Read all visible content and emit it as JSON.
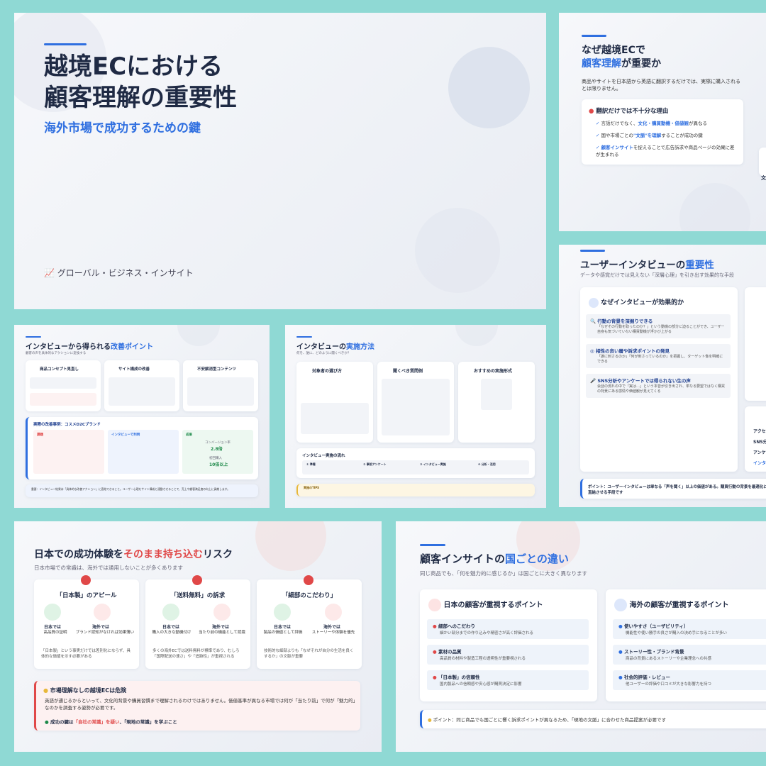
{
  "s1": {
    "title_l1": "越境ECにおける",
    "title_l2": "顧客理解の重要性",
    "subtitle": "海外市場で成功するための鍵",
    "footer": "グローバル・ビジネス・インサイト",
    "footer_icon": "chart-line-icon"
  },
  "s2": {
    "title_l1": "なぜ越境ECで",
    "title_l2a": "顧客理解",
    "title_l2b": "が重要か",
    "desc": "商品やサイトを日本語から英語に翻訳するだけでは、実際に購入されるとは限りません。",
    "card_title": "翻訳だけでは不十分な理由",
    "b1a": "言語だけでなく、",
    "b1b": "文化・購買動機・価値観",
    "b1c": "が異なる",
    "b2a": "国や市場ごとの",
    "b2b": "\"文脈\"を理解",
    "b2c": "することが成功の鍵",
    "b3a": "顧客インサイト",
    "b3b": "を捉えることで広告訴求や商品ページの効果に差が生まれる",
    "cut": "文"
  },
  "s3": {
    "title_a": "ユーザーインタビューの",
    "title_b": "重要性",
    "desc": "データや感覚だけでは見えない「深層心理」を引き出す効果的な手段",
    "card_title": "なぜインタビューが効果的か",
    "i1_t": "行動の背景を深掘りできる",
    "i1_d": "「なぜその行動を取ったのか？」という動機の部分に迫ることができ、ユーザー自身も気づいていない購買動機が浮かび上がる",
    "i2_t": "相性の良い層や訴求ポイントの発見",
    "i2_d": "「誰に刺さるのか」「何が刺さっているのか」を把握し、ターゲット像を明確にできる",
    "i3_t": "SNS分析やアンケートでは得られない生の声",
    "i3_d": "会話の流れの中で「実は…」という本音が引き出され、単なる要望ではなく購買の背景にある感情や価値観が見えてくる",
    "side1": "アクセ",
    "side2": "SNS分",
    "side3": "アンケ",
    "side4": "インタ",
    "point": "ポイント：ユーザーインタビューは単なる「声を聞く」以上の価値がある。購買行動の背景を最適化に直結させる手段です"
  },
  "s4": {
    "title_a": "インタビューから得られる",
    "title_b": "改善ポイント",
    "desc": "顧客の声を具体的なアクションに変換する",
    "c1": "商品コンセプト見直し",
    "c2": "サイト構成の改善",
    "c3": "不安解消型コンテンツ",
    "case_title": "実際の改善事例：コスメD2Cブランド",
    "case_l": "課題",
    "case_m": "インタビューで判明",
    "case_r": "成果",
    "r1": "コンバージョン率",
    "r1v": "2.8倍",
    "r2": "初回購入",
    "r2v": "10倍以上",
    "note": "重要：インタビュー結果は「具体的な改善アクション」に直結できること。ユーザー心理をサイト構成と連動させることで、売上や顧客満足度の向上に貢献します。"
  },
  "s5": {
    "title_a": "インタビューの",
    "title_b": "実施方法",
    "desc": "何を、誰に、どのように聞くべきか？",
    "c1": "対象者の選び方",
    "c2": "聞くべき質問例",
    "c3": "おすすめの実施形式",
    "flow": "インタビュー実施の流れ",
    "f1": "① 準備",
    "f2": "② 事前アンケート",
    "f3": "③ インタビュー実施",
    "f4": "④ 分析・活用",
    "tips": "実施のTIPS"
  },
  "s6": {
    "title_a": "日本での成功体験を",
    "title_b": "そのまま持ち込む",
    "title_c": "リスク",
    "desc": "日本市場での常識は、海外では通用しないことが多くあります",
    "k1": "「日本製」のアピール",
    "k1_jp": "日本では",
    "k1_jp2": "高品質の証明",
    "k1_os": "海外では",
    "k1_os2": "ブランド認知がなければ効果薄い",
    "k1_note": "「日本製」という事実だけでは差別化にならず、具体的な価値を示す必要がある",
    "k2": "「送料無料」の訴求",
    "k2_jp": "日本では",
    "k2_jp2": "購入の大きな動機付け",
    "k2_os": "海外では",
    "k2_os2": "当たり前の機能として認識",
    "k2_note": "多くの海外ECでは送料無料が標準であり、むしろ「国際配送の速さ」や「追跡性」が重視される",
    "k3": "「細部のこだわり」",
    "k3_jp": "日本では",
    "k3_jp2": "製品の価値として評価",
    "k3_os": "海外では",
    "k3_os2": "ストーリーや体験を優先",
    "k3_note": "技術的な細部よりも「なぜそれが自分の生活を良くするか」の文脈が重要",
    "warn_title": "市場理解なしの越境ECは危険",
    "warn_body": "英語が通じるからといって、文化的背景や購買習慣まで理解されるわけではありません。価値基準が異なる市場では何が「当たり前」で何が「魅力的」なのかを調査する姿勢が必要です。",
    "warn_key_a": "成功の鍵は",
    "warn_key_b": "「自社の常識」を疑い",
    "warn_key_c": "、「現地の常識」を学ぶこと"
  },
  "s7": {
    "title_a": "顧客インサイトの",
    "title_b": "国ごとの違い",
    "desc": "同じ商品でも、「何を魅力的に感じるか」は国ごとに大きく異なります",
    "jp_title": "日本の顧客が重視するポイント",
    "jp1": "細部へのこだわり",
    "jp1d": "細かい部分までの作り込みや精密さが高く評価される",
    "jp2": "素材の品質",
    "jp2d": "高品質の材料や製造工程の透明性が重要視される",
    "jp3": "「日本製」の信頼性",
    "jp3d": "国内製品への信頼感や安心感が購買決定に影響",
    "os_title": "海外の顧客が重視するポイント",
    "os1": "使いやすさ（ユーザビリティ）",
    "os1d": "機能性や使い勝手の良さが購入の決め手になることが多い",
    "os2": "ストーリー性・ブランド背景",
    "os2d": "商品の背景にあるストーリーや企業理念への共感",
    "os3": "社会的評価・レビュー",
    "os3d": "他ユーザーの評価や口コミが大きな影響力を持つ",
    "point": "ポイント：同じ商品でも国ごとに響く訴求ポイントが異なるため、「現地の文脈」に合わせた商品提案が必要です"
  },
  "colors": {
    "accent": "#2f6fe0",
    "red": "#e04848",
    "bg": "#8fd9d4"
  }
}
